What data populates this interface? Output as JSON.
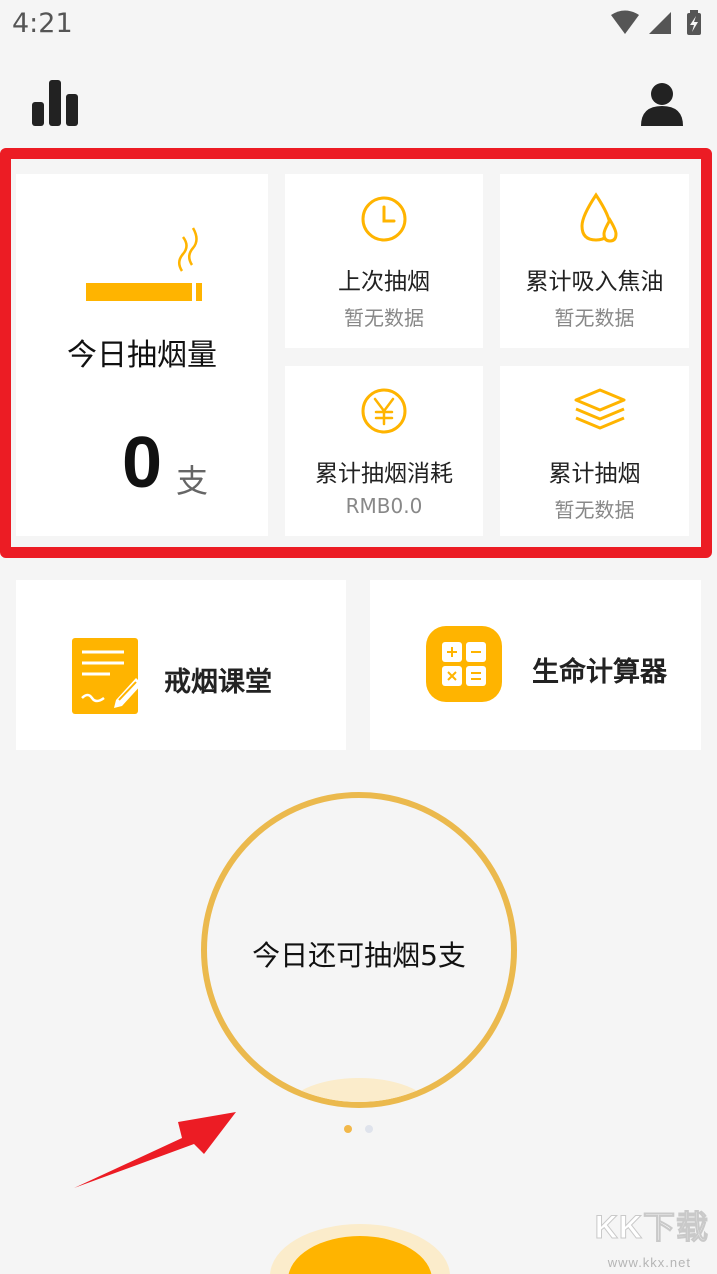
{
  "status": {
    "time": "4:21"
  },
  "stats": {
    "today_label": "今日抽烟量",
    "today_count": "0",
    "today_unit": "支",
    "tiles": [
      {
        "icon": "clock-icon",
        "label": "上次抽烟",
        "value": "暂无数据"
      },
      {
        "icon": "tar-drop-icon",
        "label": "累计吸入焦油",
        "value": "暂无数据"
      },
      {
        "icon": "yen-coin-icon",
        "label": "累计抽烟消耗",
        "value": "RMB0.0"
      },
      {
        "icon": "layers-icon",
        "label": "累计抽烟",
        "value": "暂无数据"
      }
    ]
  },
  "tools": {
    "class_label": "戒烟课堂",
    "calculator_label": "生命计算器"
  },
  "remaining": {
    "text": "今日还可抽烟5支"
  },
  "pager": {
    "pages": 2,
    "current": 1
  },
  "watermark": {
    "text": "KK下载",
    "url": "www.kkx.net"
  },
  "colors": {
    "accent": "#ffb400",
    "ring": "#ebb94d",
    "highlight": "#ec1c24",
    "background": "#f5f5f5"
  }
}
